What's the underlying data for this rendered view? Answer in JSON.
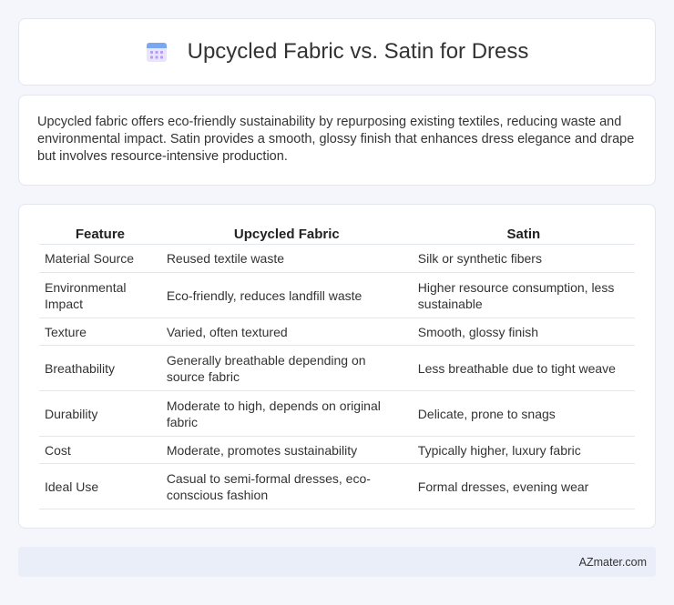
{
  "header": {
    "title": "Upcycled Fabric vs. Satin for Dress",
    "icon": "calendar-icon"
  },
  "summary": {
    "text": "Upcycled fabric offers eco-friendly sustainability by repurposing existing textiles, reducing waste and environmental impact. Satin provides a smooth, glossy finish that enhances dress elegance and drape but involves resource-intensive production."
  },
  "table": {
    "headers": [
      "Feature",
      "Upcycled Fabric",
      "Satin"
    ],
    "rows": [
      [
        "Material Source",
        "Reused textile waste",
        "Silk or synthetic fibers"
      ],
      [
        "Environmental Impact",
        "Eco-friendly, reduces landfill waste",
        "Higher resource consumption, less sustainable"
      ],
      [
        "Texture",
        "Varied, often textured",
        "Smooth, glossy finish"
      ],
      [
        "Breathability",
        "Generally breathable depending on source fabric",
        "Less breathable due to tight weave"
      ],
      [
        "Durability",
        "Moderate to high, depends on original fabric",
        "Delicate, prone to snags"
      ],
      [
        "Cost",
        "Moderate, promotes sustainability",
        "Typically higher, luxury fabric"
      ],
      [
        "Ideal Use",
        "Casual to semi-formal dresses, eco-conscious fashion",
        "Formal dresses, evening wear"
      ]
    ]
  },
  "footer": {
    "brand": "AZmater.com"
  }
}
